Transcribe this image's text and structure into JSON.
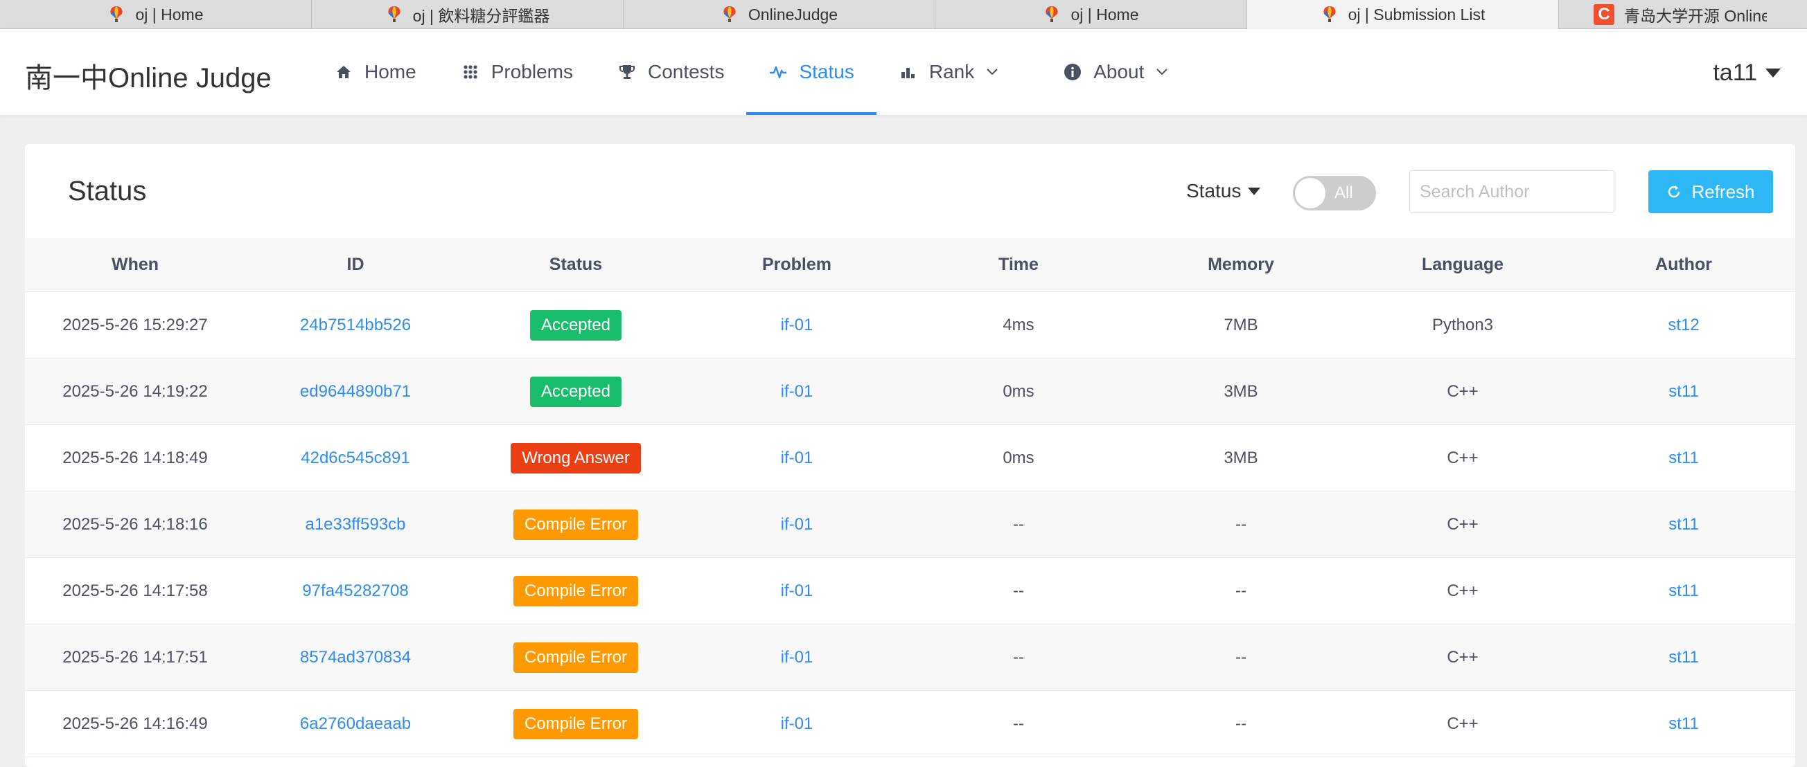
{
  "browser": {
    "tabs": [
      {
        "title": "oj | Home",
        "active": false
      },
      {
        "title": "oj | 飲料糖分評鑑器",
        "active": false
      },
      {
        "title": "OnlineJudge",
        "active": false
      },
      {
        "title": "oj | Home",
        "active": false
      },
      {
        "title": "oj | Submission List",
        "active": true
      },
      {
        "title": "青岛大学开源 Online Judge |",
        "active": false
      }
    ]
  },
  "header": {
    "logo": "南一中Online Judge",
    "nav": [
      {
        "label": "Home",
        "icon": "home-icon"
      },
      {
        "label": "Problems",
        "icon": "grid-icon"
      },
      {
        "label": "Contests",
        "icon": "trophy-icon"
      },
      {
        "label": "Status",
        "icon": "pulse-icon",
        "active": true
      },
      {
        "label": "Rank",
        "icon": "bar-chart-icon",
        "dropdown": true
      },
      {
        "label": "About",
        "icon": "info-icon",
        "dropdown": true
      }
    ],
    "user": "ta11"
  },
  "status_panel": {
    "title": "Status",
    "filter_label": "Status",
    "switch_label": "All",
    "search_placeholder": "Search Author",
    "refresh_label": "Refresh"
  },
  "table": {
    "columns": [
      "When",
      "ID",
      "Status",
      "Problem",
      "Time",
      "Memory",
      "Language",
      "Author"
    ],
    "rows": [
      {
        "when": "2025-5-26 15:29:27",
        "id": "24b7514bb526",
        "status": "Accepted",
        "status_color": "#19be6b",
        "problem": "if-01",
        "time": "4ms",
        "memory": "7MB",
        "language": "Python3",
        "author": "st12"
      },
      {
        "when": "2025-5-26 14:19:22",
        "id": "ed9644890b71",
        "status": "Accepted",
        "status_color": "#19be6b",
        "problem": "if-01",
        "time": "0ms",
        "memory": "3MB",
        "language": "C++",
        "author": "st11"
      },
      {
        "when": "2025-5-26 14:18:49",
        "id": "42d6c545c891",
        "status": "Wrong Answer",
        "status_color": "#ed3f14",
        "problem": "if-01",
        "time": "0ms",
        "memory": "3MB",
        "language": "C++",
        "author": "st11"
      },
      {
        "when": "2025-5-26 14:18:16",
        "id": "a1e33ff593cb",
        "status": "Compile Error",
        "status_color": "#ff9900",
        "problem": "if-01",
        "time": "--",
        "memory": "--",
        "language": "C++",
        "author": "st11"
      },
      {
        "when": "2025-5-26 14:17:58",
        "id": "97fa45282708",
        "status": "Compile Error",
        "status_color": "#ff9900",
        "problem": "if-01",
        "time": "--",
        "memory": "--",
        "language": "C++",
        "author": "st11"
      },
      {
        "when": "2025-5-26 14:17:51",
        "id": "8574ad370834",
        "status": "Compile Error",
        "status_color": "#ff9900",
        "problem": "if-01",
        "time": "--",
        "memory": "--",
        "language": "C++",
        "author": "st11"
      },
      {
        "when": "2025-5-26 14:16:49",
        "id": "6a2760daeaab",
        "status": "Compile Error",
        "status_color": "#ff9900",
        "problem": "if-01",
        "time": "--",
        "memory": "--",
        "language": "C++",
        "author": "st11"
      }
    ]
  }
}
